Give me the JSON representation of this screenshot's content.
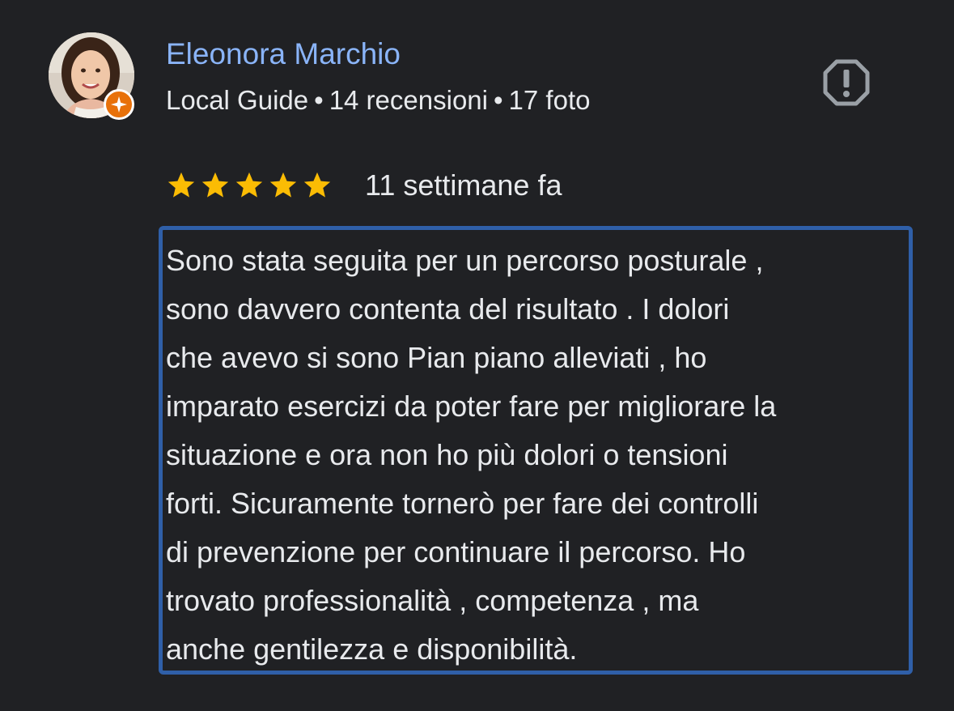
{
  "reviewer": {
    "name": "Eleonora Marchio",
    "guide_label": "Local Guide",
    "separator": "•",
    "reviews_count": "14 recensioni",
    "photos_count": "17 foto",
    "avatar_icon": "person-photo",
    "badge_icon": "local-guide-star-icon"
  },
  "actions": {
    "report_icon": "report-flag-icon"
  },
  "rating": {
    "stars": 5,
    "max_stars": 5,
    "time_ago": "11 settimane fa",
    "star_color": "#fbbc04"
  },
  "review": {
    "text": "Sono stata seguita per un percorso posturale ,\nsono davvero contenta del risultato . I dolori\nche avevo si sono Pian piano alleviati , ho\nimparato esercizi da poter fare per migliorare la\nsituazione e ora non ho più dolori o tensioni\nforti. Sicuramente tornerò per fare dei controlli\ndi prevenzione per continuare il percorso. Ho\ntrovato professionalità , competenza , ma\nanche gentilezza e disponibilità.",
    "highlight_color": "#2f5fa8"
  },
  "colors": {
    "background": "#202124",
    "name": "#8ab4f8",
    "text": "#e8eaed",
    "badge": "#e8710a"
  }
}
